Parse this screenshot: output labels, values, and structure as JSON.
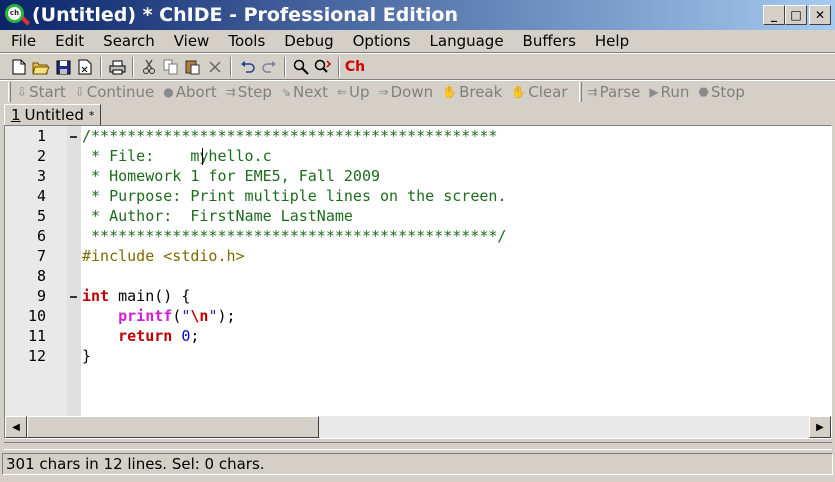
{
  "window": {
    "title": "(Untitled) * ChIDE - Professional Edition",
    "icon_text": "ch"
  },
  "window_controls": {
    "minimize": "_",
    "maximize": "□",
    "close": "✕"
  },
  "menu": [
    "File",
    "Edit",
    "Search",
    "View",
    "Tools",
    "Debug",
    "Options",
    "Language",
    "Buffers",
    "Help"
  ],
  "toolbar": {
    "icons": [
      "new-file-icon",
      "open-folder-icon",
      "save-icon",
      "close-file-icon",
      "print-icon",
      "cut-icon",
      "copy-icon",
      "paste-icon",
      "delete-icon",
      "undo-icon",
      "redo-icon",
      "find-icon",
      "replace-icon"
    ],
    "ch_label": "Ch"
  },
  "debug_toolbar": [
    {
      "label": "Start",
      "icon": "⇩"
    },
    {
      "label": "Continue",
      "icon": "⇩"
    },
    {
      "label": "Abort",
      "icon": "●"
    },
    {
      "label": "Step",
      "icon": "⇉"
    },
    {
      "label": "Next",
      "icon": "⇘"
    },
    {
      "label": "Up",
      "icon": "⇐"
    },
    {
      "label": "Down",
      "icon": "⇒"
    },
    {
      "label": "Break",
      "icon": "✋"
    },
    {
      "label": "Clear",
      "icon": "✋"
    },
    {
      "label": "Parse",
      "icon": "⇉"
    },
    {
      "label": "Run",
      "icon": "▶"
    },
    {
      "label": "Stop",
      "icon": "⬣"
    }
  ],
  "tab": {
    "number": "1",
    "label": "Untitled",
    "modified_mark": "*"
  },
  "editor": {
    "lines": [
      {
        "num": "1",
        "text": "/*********************************************"
      },
      {
        "num": "2",
        "text": " * File:    myhello.c"
      },
      {
        "num": "3",
        "text": " * Homework 1 for EME5, Fall 2009"
      },
      {
        "num": "4",
        "text": " * Purpose: Print multiple lines on the screen."
      },
      {
        "num": "5",
        "text": " * Author:  FirstName LastName"
      },
      {
        "num": "6",
        "text": " *********************************************/"
      },
      {
        "num": "7",
        "text": "#include <stdio.h>"
      },
      {
        "num": "8",
        "text": ""
      },
      {
        "num": "9",
        "text": "int main() {"
      },
      {
        "num": "10",
        "text": "    printf(\"\\n\");"
      },
      {
        "num": "11",
        "text": "    return 0;"
      },
      {
        "num": "12",
        "text": "}"
      }
    ]
  },
  "status": {
    "text": "301 chars in 12 lines. Sel: 0 chars."
  },
  "colors": {
    "comment": "#1d6b1d",
    "preprocessor": "#7d6b00",
    "keyword": "#c00000",
    "function": "#d020d0",
    "number": "#0000c8",
    "titlebar_start": "#0a246a",
    "titlebar_end": "#a6caf0"
  }
}
